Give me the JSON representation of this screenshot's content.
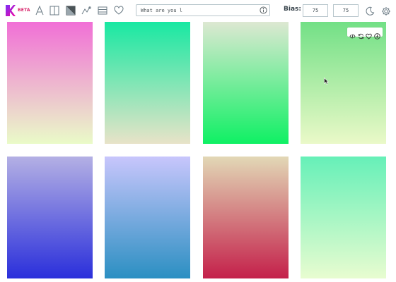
{
  "header": {
    "beta_label": "BETA",
    "tools": [
      "font-icon",
      "split-columns-icon",
      "gradient-square-icon",
      "chart-line-icon",
      "list-icon",
      "heart-icon"
    ],
    "search": {
      "placeholder": "What are you l",
      "value": ""
    },
    "bias": {
      "label": "Bias:",
      "value1": "75",
      "value2": "75"
    },
    "right_icons": [
      "moon-icon",
      "settings-gear-icon"
    ]
  },
  "colors": {
    "brand_start": "#7b2ff7",
    "brand_end": "#f107a3",
    "beta_color": "#d8246b",
    "icon_stroke": "#6b7b85"
  },
  "gradients": [
    {
      "top": "#f16fd6",
      "bottom": "#eafbc8"
    },
    {
      "top": "#18e8a2",
      "bottom": "#e8e3c8"
    },
    {
      "top": "#dde8d2",
      "bottom": "#0ff064"
    },
    {
      "top": "#72e086",
      "bottom": "#eaf9c8"
    },
    {
      "top": "#b4b0e4",
      "bottom": "#2a2fdb"
    },
    {
      "top": "#c8c6fc",
      "bottom": "#2b8fc2"
    },
    {
      "top": "#e2d8b6",
      "bottom": "#c4204a"
    },
    {
      "top": "#66f0b8",
      "bottom": "#e8fcd0"
    }
  ],
  "card_toolbar": [
    "code-icon",
    "refresh-icon",
    "heart-icon",
    "download-icon"
  ]
}
